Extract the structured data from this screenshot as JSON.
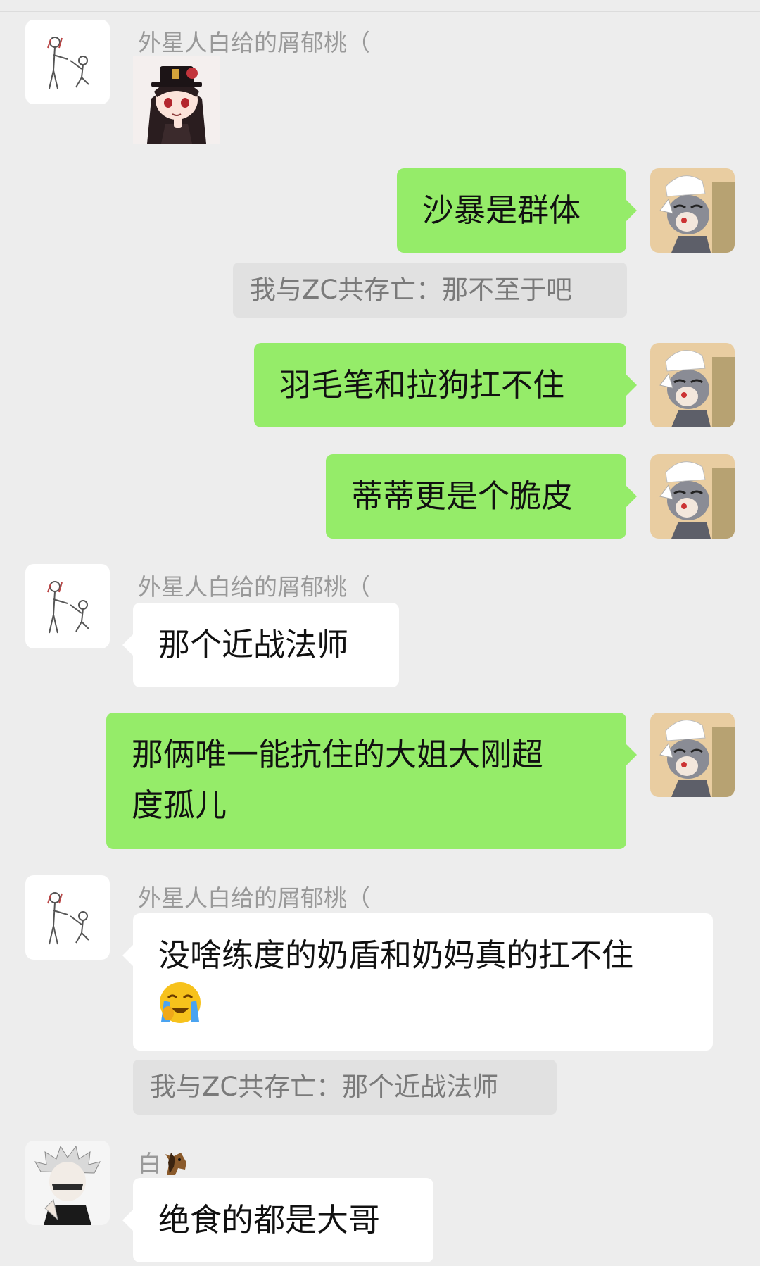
{
  "messages": [
    {
      "sender": "外星人白给的屑郁桃（",
      "sticker": "hutao-sticker"
    },
    {
      "text": "沙暴是群体"
    },
    {
      "quote": "我与ZC共存亡：那不至于吧"
    },
    {
      "text": "羽毛笔和拉狗扛不住"
    },
    {
      "text": "蒂蒂更是个脆皮"
    },
    {
      "sender": "外星人白给的屑郁桃（",
      "text": "那个近战法师"
    },
    {
      "text_line1": "那俩唯一能抗住的大姐大刚超",
      "text_line2": "度孤儿"
    },
    {
      "sender": "外星人白给的屑郁桃（",
      "text": "没啥练度的奶盾和奶妈真的扛不住",
      "emoji": "loudly-crying-face-emoji",
      "quote": "我与ZC共存亡：那个近战法师"
    },
    {
      "sender": "白",
      "sender_emoji": "horse-face-emoji",
      "text": "绝食的都是大哥"
    }
  ],
  "colors": {
    "background": "#ededed",
    "my_bubble": "#95ec69",
    "their_bubble": "#ffffff",
    "quote_bg": "#e1e1e1",
    "sender_text": "#999999"
  }
}
